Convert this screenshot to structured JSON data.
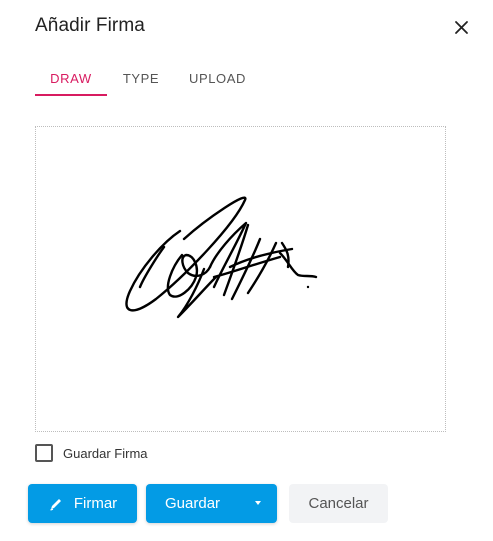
{
  "dialog": {
    "title": "Añadir Firma",
    "close_icon": "close-icon"
  },
  "tabs": [
    {
      "label": "DRAW",
      "active": true
    },
    {
      "label": "TYPE",
      "active": false
    },
    {
      "label": "UPLOAD",
      "active": false
    }
  ],
  "save_signature": {
    "label": "Guardar Firma",
    "checked": false
  },
  "buttons": {
    "sign_label": "Firmar",
    "sign_icon": "pen-icon",
    "save_label": "Guardar",
    "save_dropdown_icon": "caret-down-icon",
    "cancel_label": "Cancelar"
  },
  "colors": {
    "accent_tab": "#d81b60",
    "primary_button": "#039be5",
    "cancel_button_bg": "#f2f3f5"
  }
}
